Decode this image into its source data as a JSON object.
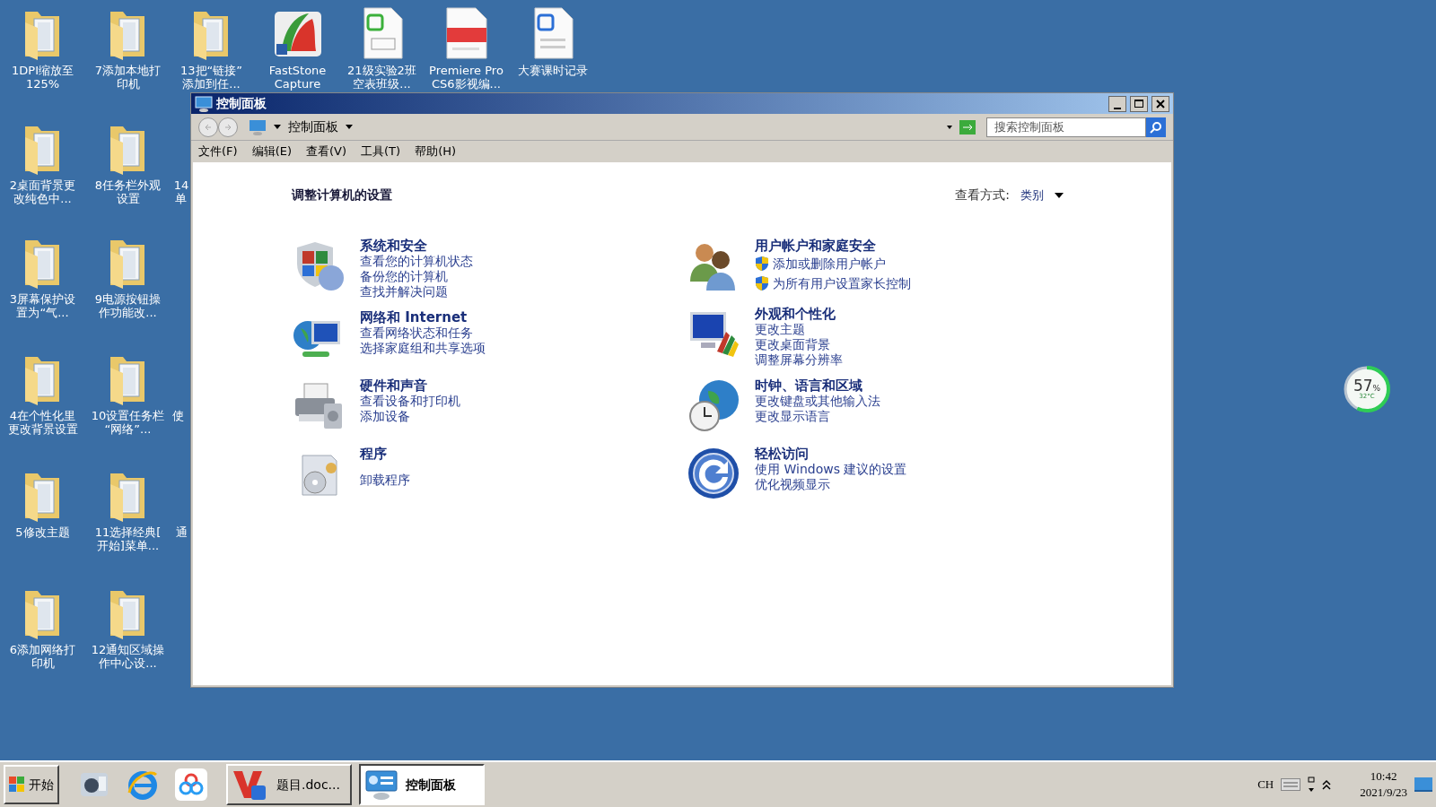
{
  "desktop_icons": [
    {
      "kind": "folder",
      "lines": [
        "1DPI缩放至",
        "125%"
      ]
    },
    {
      "kind": "folder",
      "lines": [
        "7添加本地打",
        "印机"
      ]
    },
    {
      "kind": "folder",
      "lines": [
        "13把“链接”",
        "添加到任..."
      ]
    },
    {
      "kind": "faststone",
      "lines": [
        "FastStone",
        "Capture"
      ]
    },
    {
      "kind": "sheet",
      "lines": [
        "21级实验2班",
        "空表班级..."
      ]
    },
    {
      "kind": "pdf",
      "lines": [
        "Premiere Pro",
        "CS6影视编..."
      ]
    },
    {
      "kind": "word",
      "lines": [
        "大赛课时记录"
      ]
    },
    {
      "kind": "folder",
      "lines": [
        "2桌面背景更",
        "改纯色中..."
      ]
    },
    {
      "kind": "folder",
      "lines": [
        "8任务栏外观",
        "设置"
      ]
    },
    {
      "kind": "cut",
      "lines": [
        "14",
        "单"
      ]
    },
    {
      "kind": "folder",
      "lines": [
        "3屏幕保护设",
        "置为“气..."
      ]
    },
    {
      "kind": "folder",
      "lines": [
        "9电源按钮操",
        "作功能改..."
      ]
    },
    {
      "kind": "folder",
      "lines": [
        "4在个性化里",
        "更改背景设置"
      ]
    },
    {
      "kind": "folder",
      "lines": [
        "10设置任务栏",
        "“网络”..."
      ]
    },
    {
      "kind": "cut",
      "lines": [
        "使"
      ]
    },
    {
      "kind": "folder",
      "lines": [
        "5修改主题"
      ]
    },
    {
      "kind": "folder",
      "lines": [
        "11选择经典[",
        "开始]菜单..."
      ]
    },
    {
      "kind": "cut",
      "lines": [
        "通"
      ]
    },
    {
      "kind": "folder",
      "lines": [
        "6添加网络打",
        "印机"
      ]
    },
    {
      "kind": "folder",
      "lines": [
        "12通知区域操",
        "作中心设..."
      ]
    }
  ],
  "window": {
    "title": "控制面板",
    "address": "控制面板",
    "search": {
      "placeholder": "搜索控制面板"
    },
    "menu": [
      "文件(F)",
      "编辑(E)",
      "查看(V)",
      "工具(T)",
      "帮助(H)"
    ],
    "heading": "调整计算机的设置",
    "view_label": "查看方式:",
    "view_value": "类别",
    "columns": [
      [
        {
          "kind": "security",
          "title": "系统和安全",
          "links": [
            {
              "text": "查看您的计算机状态",
              "shield": false
            },
            {
              "text": "备份您的计算机",
              "shield": false
            },
            {
              "text": "查找并解决问题",
              "shield": false
            }
          ]
        },
        {
          "kind": "network",
          "title": "网络和 Internet",
          "links": [
            {
              "text": "查看网络状态和任务",
              "shield": false
            },
            {
              "text": "选择家庭组和共享选项",
              "shield": false
            }
          ]
        },
        {
          "kind": "hardware",
          "title": "硬件和声音",
          "links": [
            {
              "text": "查看设备和打印机",
              "shield": false
            },
            {
              "text": "添加设备",
              "shield": false
            }
          ]
        },
        {
          "kind": "programs",
          "title": "程序",
          "links": [
            {
              "text": "卸载程序",
              "shield": false
            }
          ]
        }
      ],
      [
        {
          "kind": "users",
          "title": "用户帐户和家庭安全",
          "links": [
            {
              "text": "添加或删除用户帐户",
              "shield": true
            },
            {
              "text": "为所有用户设置家长控制",
              "shield": true
            }
          ]
        },
        {
          "kind": "appearance",
          "title": "外观和个性化",
          "links": [
            {
              "text": "更改主题",
              "shield": false
            },
            {
              "text": "更改桌面背景",
              "shield": false
            },
            {
              "text": "调整屏幕分辨率",
              "shield": false
            }
          ]
        },
        {
          "kind": "clock",
          "title": "时钟、语言和区域",
          "links": [
            {
              "text": "更改键盘或其他输入法",
              "shield": false
            },
            {
              "text": "更改显示语言",
              "shield": false
            }
          ]
        },
        {
          "kind": "access",
          "title": "轻松访问",
          "links": [
            {
              "text": "使用 Windows 建议的设置",
              "shield": false
            },
            {
              "text": "优化视频显示",
              "shield": false
            }
          ]
        }
      ]
    ]
  },
  "gauge": {
    "value": "57",
    "unit": "%",
    "temperature": "32°C",
    "level": 0.57
  },
  "taskbar": {
    "start": "开始",
    "quick_launch": [
      {
        "kind": "player"
      },
      {
        "kind": "browser"
      },
      {
        "kind": "cloud"
      }
    ],
    "tasks": [
      {
        "kind": "wps",
        "label": "题目.doc...",
        "selected": false
      },
      {
        "kind": "panel",
        "label": "控制面板",
        "selected": true
      }
    ],
    "language": "CH",
    "time": "10:42",
    "date": "2021/9/23"
  }
}
